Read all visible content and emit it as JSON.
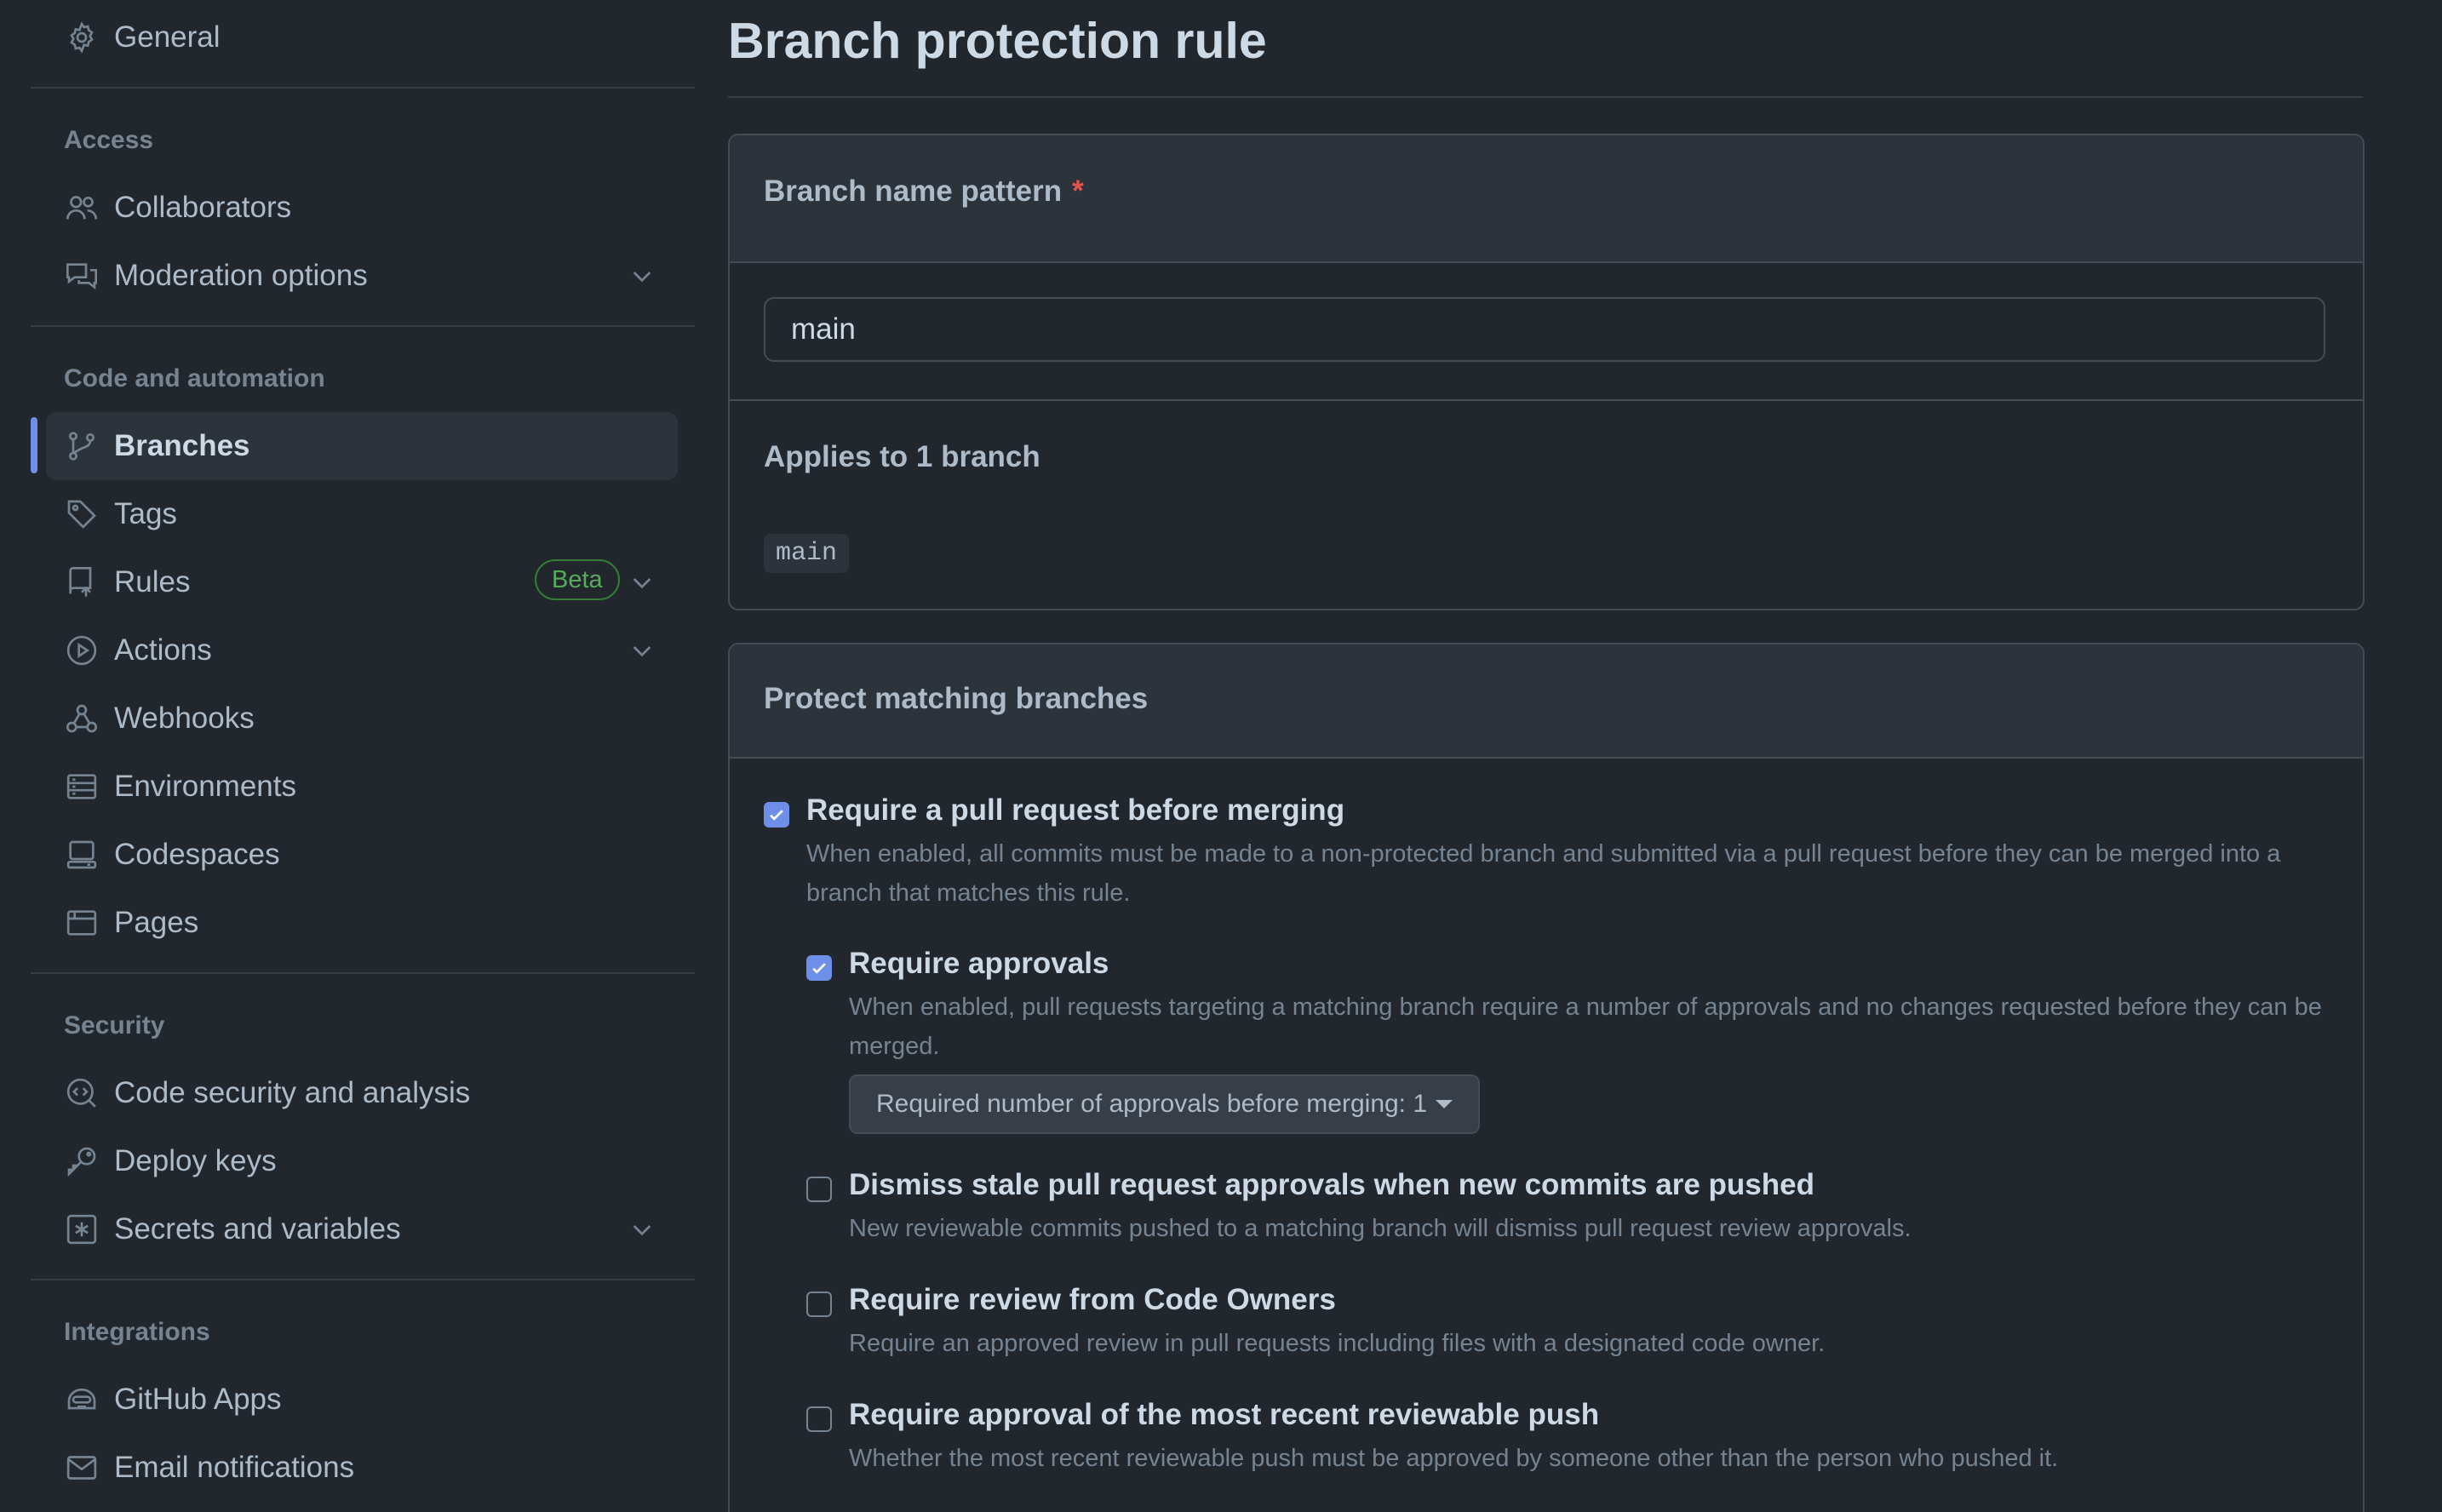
{
  "sidebar": {
    "general": "General",
    "sections": {
      "access": "Access",
      "code_automation": "Code and automation",
      "security": "Security",
      "integrations": "Integrations"
    },
    "items": {
      "collaborators": "Collaborators",
      "moderation": "Moderation options",
      "branches": "Branches",
      "tags": "Tags",
      "rules": "Rules",
      "rules_badge": "Beta",
      "actions": "Actions",
      "webhooks": "Webhooks",
      "environments": "Environments",
      "codespaces": "Codespaces",
      "pages": "Pages",
      "code_security": "Code security and analysis",
      "deploy_keys": "Deploy keys",
      "secrets": "Secrets and variables",
      "github_apps": "GitHub Apps",
      "email_notifications": "Email notifications"
    },
    "active_item": "Branches",
    "icons": {
      "general": "gear-icon",
      "collaborators": "people-icon",
      "moderation": "comment-discussion-icon",
      "branches": "git-branch-icon",
      "tags": "tag-icon",
      "rules": "repo-push-icon",
      "actions": "play-icon",
      "webhooks": "webhook-icon",
      "environments": "server-icon",
      "codespaces": "codespaces-icon",
      "pages": "browser-icon",
      "code_security": "codescan-icon",
      "deploy_keys": "key-icon",
      "secrets": "key-asterisk-icon",
      "github_apps": "hubot-icon",
      "email_notifications": "mail-icon"
    }
  },
  "main": {
    "title": "Branch protection rule",
    "name_pattern": {
      "label": "Branch name pattern",
      "required_marker": "*",
      "value": "main"
    },
    "applies": {
      "label": "Applies to 1 branch",
      "branches": [
        "main"
      ]
    },
    "protect": {
      "header": "Protect matching branches",
      "options": {
        "require_pr": {
          "title": "Require a pull request before merging",
          "desc": "When enabled, all commits must be made to a non-protected branch and submitted via a pull request before they can be merged into a branch that matches this rule.",
          "checked": true
        },
        "require_approvals": {
          "title": "Require approvals",
          "desc": "When enabled, pull requests targeting a matching branch require a number of approvals and no changes requested before they can be merged.",
          "checked": true,
          "select_label": "Required number of approvals before merging: 1"
        },
        "dismiss_stale": {
          "title": "Dismiss stale pull request approvals when new commits are pushed",
          "desc": "New reviewable commits pushed to a matching branch will dismiss pull request review approvals.",
          "checked": false
        },
        "code_owners": {
          "title": "Require review from Code Owners",
          "desc": "Require an approved review in pull requests including files with a designated code owner.",
          "checked": false
        },
        "recent_push": {
          "title": "Require approval of the most recent reviewable push",
          "desc": "Whether the most recent reviewable push must be approved by someone other than the person who pushed it.",
          "checked": false
        }
      }
    }
  },
  "colors": {
    "background": "#22272e",
    "accent": "#6e8fe8",
    "beta_badge": "#57ab5a",
    "required_star": "#e5534b"
  }
}
